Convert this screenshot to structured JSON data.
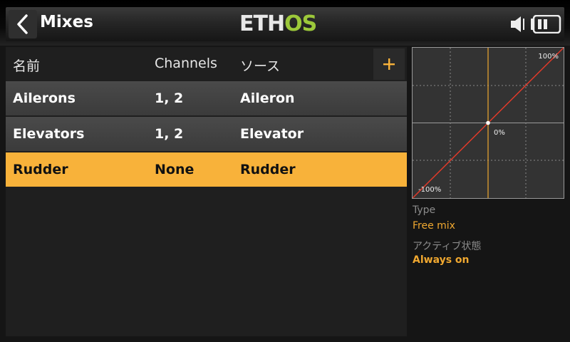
{
  "header": {
    "title": "Mixes",
    "logo_part1": "ETH",
    "logo_part2": "OS",
    "icons": [
      "back-arrow-icon",
      "speaker-icon",
      "battery-icon"
    ]
  },
  "table": {
    "columns": [
      "名前",
      "Channels",
      "ソース"
    ],
    "add_label": "+",
    "rows": [
      {
        "name": "Ailerons",
        "channels": "1, 2",
        "source": "Aileron"
      },
      {
        "name": "Elevators",
        "channels": "1, 2",
        "source": "Elevator"
      },
      {
        "name": "Rudder",
        "channels": "None",
        "source": "Rudder"
      }
    ],
    "selected_index": 2
  },
  "curve": {
    "label_max": "100%",
    "label_mid": "0%",
    "label_min": "-100%"
  },
  "details": {
    "type_label": "Type",
    "type_value": "Free mix",
    "active_label": "アクティブ状態",
    "active_value": "Always on"
  },
  "colors": {
    "accent": "#f8b23a",
    "curve_line": "#e03a2a",
    "cursor_line": "#f0a830",
    "logo_green": "#9cc83a"
  }
}
